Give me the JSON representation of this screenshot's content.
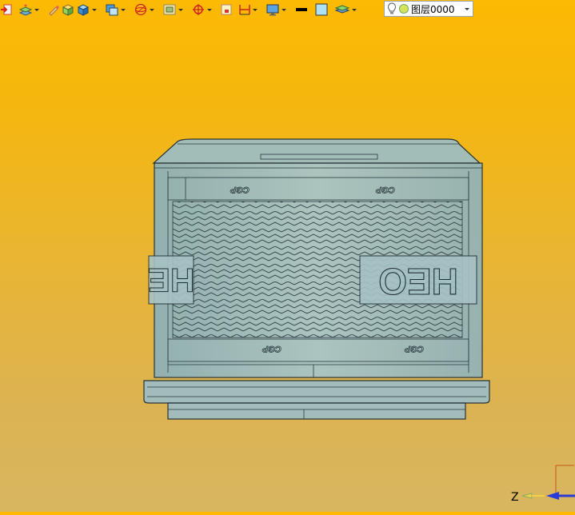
{
  "toolbar": {
    "icons": [
      "import-icon",
      "layer-tools-icon",
      "pencil-icon",
      "box-shaded-icon",
      "box-blue-icon",
      "view-cube-icon",
      "sphere-wireframe-icon",
      "display-mode-icon",
      "snap-target-icon",
      "square-select-icon",
      "dimension-icon",
      "monitor-icon",
      "line-color-icon",
      "fill-color-icon",
      "layer-stack-icon"
    ],
    "colors": {
      "line": "#000000",
      "fill": "#aee1f6"
    }
  },
  "layer": {
    "name": "图层0000"
  },
  "model": {
    "emboss_top": [
      "CGP",
      "CGP"
    ],
    "emboss_bottom": [
      "CGP",
      "CGP"
    ],
    "emboss_side_left": "HE",
    "emboss_side_right": "HEO"
  },
  "axis": {
    "label": "Z"
  },
  "colors": {
    "background_top": "#fdb903",
    "background_bottom": "#d8b660",
    "body": "#9fbdc0",
    "edge": "#1f2d33"
  }
}
